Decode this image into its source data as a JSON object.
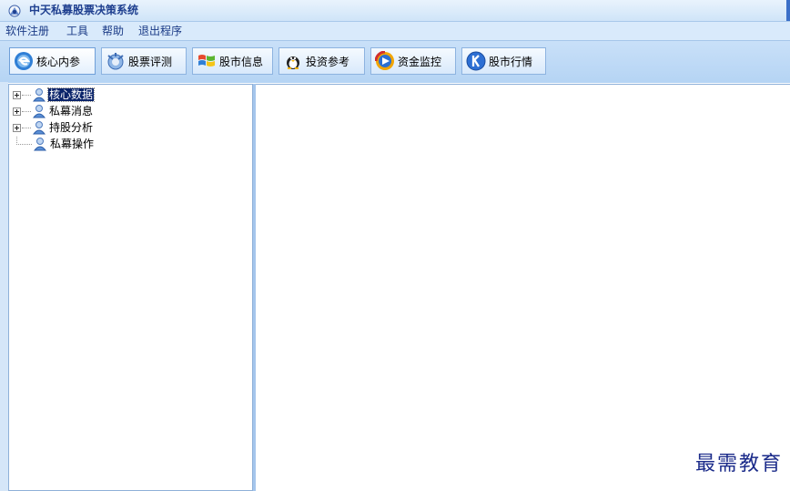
{
  "window": {
    "title": "中天私募股票决策系统"
  },
  "menu": [
    {
      "label": "软件注册"
    },
    {
      "label": "工具"
    },
    {
      "label": "帮助"
    },
    {
      "label": "退出程序"
    }
  ],
  "toolbar": [
    {
      "label": "核心内参",
      "icon": "blue-e-icon",
      "active": true
    },
    {
      "label": "股票评测",
      "icon": "medal-icon"
    },
    {
      "label": "股市信息",
      "icon": "windows-flag-icon"
    },
    {
      "label": "投资参考",
      "icon": "penguin-icon"
    },
    {
      "label": "资金监控",
      "icon": "play-disc-icon"
    },
    {
      "label": "股市行情",
      "icon": "k-circle-icon"
    }
  ],
  "tree": [
    {
      "label": "核心数据",
      "expandable": true,
      "selected": true
    },
    {
      "label": "私幕消息",
      "expandable": true
    },
    {
      "label": "持股分析",
      "expandable": true
    },
    {
      "label": "私幕操作",
      "expandable": false
    }
  ],
  "watermark": "最需教育",
  "colors": {
    "accent": "#1e3f8f",
    "toolbar": "#c9e0f8",
    "selection": "#0a246a"
  }
}
